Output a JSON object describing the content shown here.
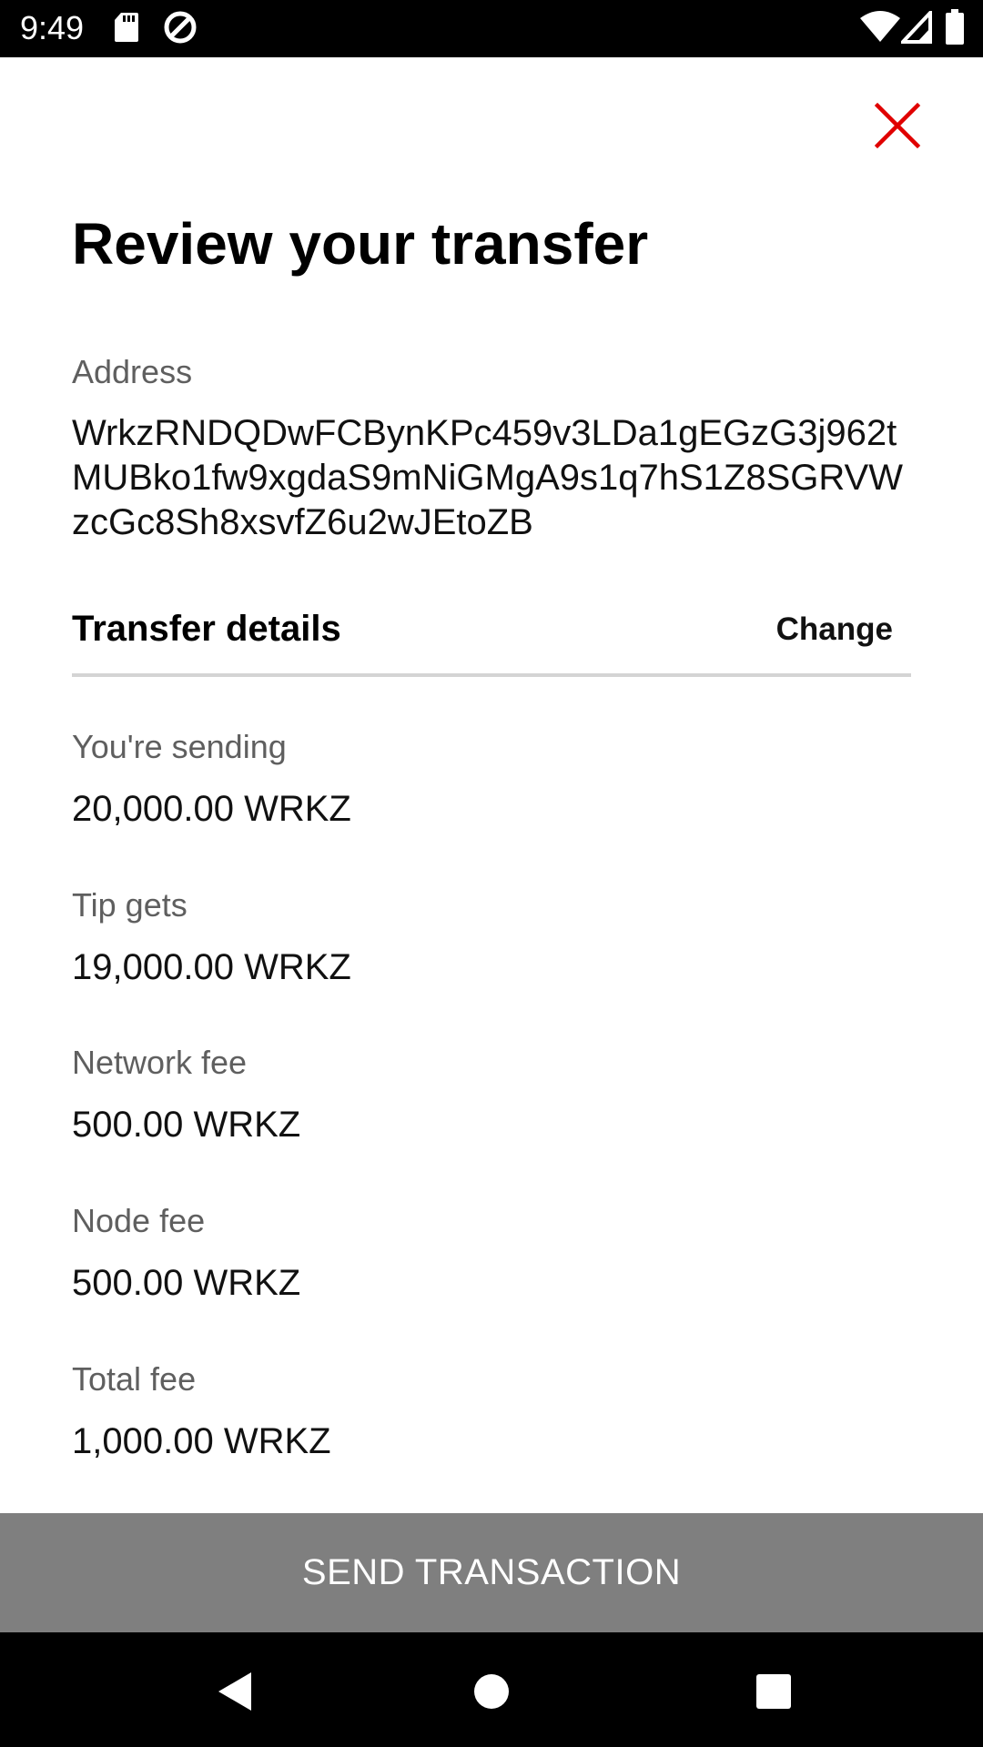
{
  "status_bar": {
    "time": "9:49",
    "icons": [
      "sd-card-icon",
      "data-saver-icon",
      "wifi-icon",
      "cell-signal-icon",
      "battery-icon"
    ]
  },
  "close_icon": "close-icon",
  "accent_color": "#e00000",
  "title": "Review your transfer",
  "address": {
    "label": "Address",
    "value": "WrkzRNDQDwFCBynKPc459v3LDa1gEGzG3j962tMUBko1fw9xgdaS9mNiGMgA9s1q7hS1Z8SGRVWzcGc8Sh8xsvfZ6u2wJEtoZB"
  },
  "transfer_details": {
    "title": "Transfer details",
    "change_label": "Change",
    "items": [
      {
        "label": "You're sending",
        "value": "20,000.00 WRKZ"
      },
      {
        "label": "Tip gets",
        "value": "19,000.00 WRKZ"
      },
      {
        "label": "Network fee",
        "value": "500.00 WRKZ"
      },
      {
        "label": "Node fee",
        "value": "500.00 WRKZ"
      },
      {
        "label": "Total fee",
        "value": "1,000.00 WRKZ"
      }
    ]
  },
  "send_button_label": "SEND TRANSACTION",
  "nav_bar": {
    "buttons": [
      "back-icon",
      "home-icon",
      "recents-icon"
    ]
  }
}
